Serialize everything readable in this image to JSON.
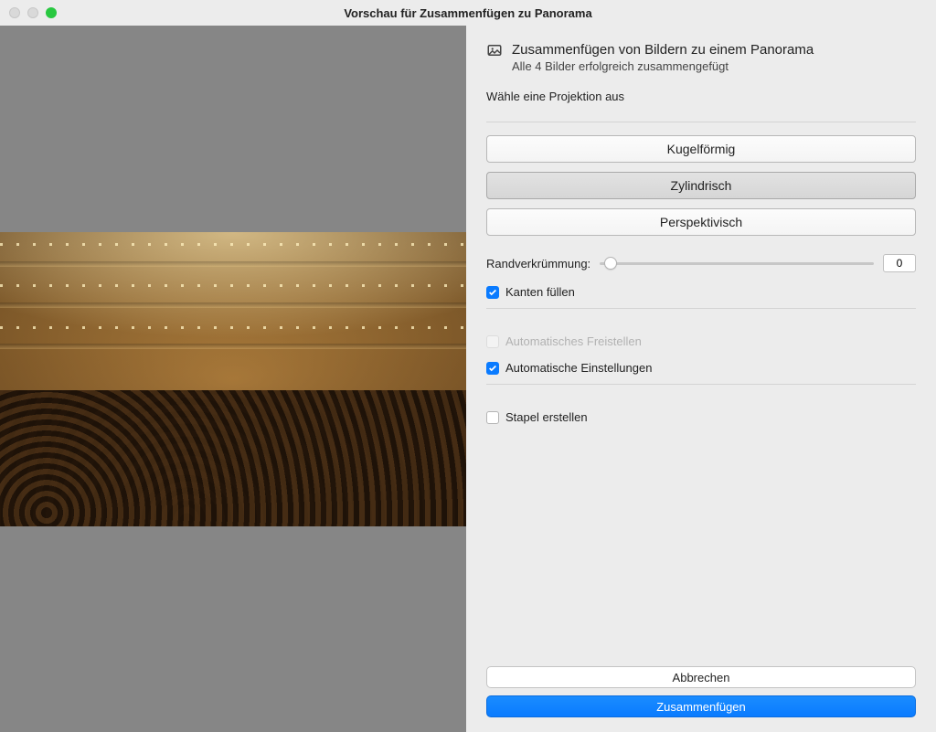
{
  "window": {
    "title": "Vorschau für Zusammenfügen zu Panorama"
  },
  "header": {
    "title": "Zusammenfügen von Bildern zu einem Panorama",
    "subtitle": "Alle 4 Bilder erfolgreich zusammengefügt"
  },
  "projection": {
    "label": "Wähle eine Projektion aus",
    "options": {
      "spherical": "Kugelförmig",
      "cylindrical": "Zylindrisch",
      "perspective": "Perspektivisch"
    },
    "selected": "cylindrical"
  },
  "boundary": {
    "label": "Randverkrümmung:",
    "value": "0"
  },
  "checks": {
    "fill_edges": {
      "label": "Kanten füllen",
      "checked": true,
      "disabled": false
    },
    "auto_crop": {
      "label": "Automatisches Freistellen",
      "checked": false,
      "disabled": true
    },
    "auto_settings": {
      "label": "Automatische Einstellungen",
      "checked": true,
      "disabled": false
    },
    "create_stack": {
      "label": "Stapel erstellen",
      "checked": false,
      "disabled": false
    }
  },
  "footer": {
    "cancel": "Abbrechen",
    "merge": "Zusammenfügen"
  }
}
